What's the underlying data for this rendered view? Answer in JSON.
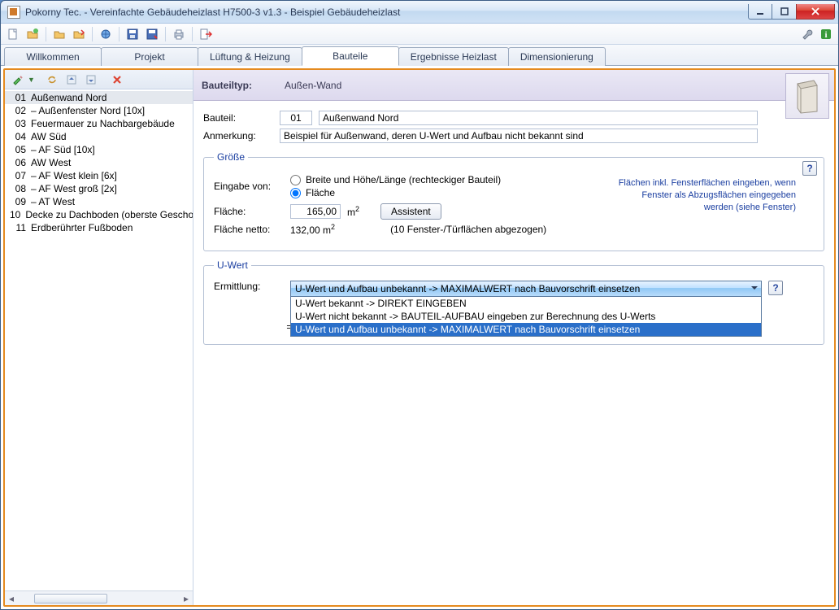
{
  "window": {
    "title": "Pokorny Tec.  -  Vereinfachte Gebäudeheizlast H7500-3 v1.3  -  Beispiel Gebäudeheizlast"
  },
  "tabs": {
    "welcome": "Willkommen",
    "project": "Projekt",
    "vent": "Lüftung & Heizung",
    "parts": "Bauteile",
    "results": "Ergebnisse Heizlast",
    "dim": "Dimensionierung"
  },
  "list": [
    {
      "n": "01",
      "t": "Außenwand Nord"
    },
    {
      "n": "02",
      "t": "  – Außenfenster Nord [10x]"
    },
    {
      "n": "03",
      "t": "Feuermauer zu Nachbargebäude"
    },
    {
      "n": "04",
      "t": "AW Süd"
    },
    {
      "n": "05",
      "t": "  – AF Süd [10x]"
    },
    {
      "n": "06",
      "t": "AW West"
    },
    {
      "n": "07",
      "t": "  – AF West klein [6x]"
    },
    {
      "n": "08",
      "t": "  – AF West groß [2x]"
    },
    {
      "n": "09",
      "t": "  – AT West"
    },
    {
      "n": "10",
      "t": "Decke zu Dachboden (oberste Geschossdecke)"
    },
    {
      "n": "11",
      "t": "Erdberührter Fußboden"
    }
  ],
  "header": {
    "typ_lbl": "Bauteiltyp:",
    "typ_val": "Außen-Wand"
  },
  "form": {
    "bauteil_lbl": "Bauteil:",
    "bauteil_num": "01",
    "bauteil_name": "Außenwand Nord",
    "anm_lbl": "Anmerkung:",
    "anm_val": "Beispiel für Außenwand, deren U-Wert und Aufbau nicht bekannt sind"
  },
  "groesse": {
    "legend": "Größe",
    "eingabe_lbl": "Eingabe von:",
    "opt_bh": "Breite und Höhe/Länge (rechteckiger Bauteil)",
    "opt_fl": "Fläche",
    "flaeche_lbl": "Fläche:",
    "flaeche_val": "165,00",
    "unit": "m",
    "assist": "Assistent",
    "netto_lbl": "Fläche netto:",
    "netto_val": "132,00 m",
    "netto_note": "(10 Fenster-/Türflächen abgezogen)",
    "hint": "Flächen inkl. Fensterflächen eingeben, wenn Fenster als Abzugsflächen eingegeben werden (siehe Fenster)"
  },
  "uwert": {
    "legend": "U-Wert",
    "erm_lbl": "Ermittlung:",
    "selected": "U-Wert und Aufbau unbekannt -> MAXIMALWERT nach Bauvorschrift einsetzen",
    "opt1": "U-Wert bekannt -> DIREKT EINGEBEN",
    "opt2": "U-Wert nicht bekannt -> BAUTEIL-AUFBAU eingeben zur Berechnung des U-Werts",
    "opt3": "U-Wert und Aufbau unbekannt -> MAXIMALWERT nach Bauvorschrift einsetzen",
    "eq": "=> U-Wert ="
  }
}
